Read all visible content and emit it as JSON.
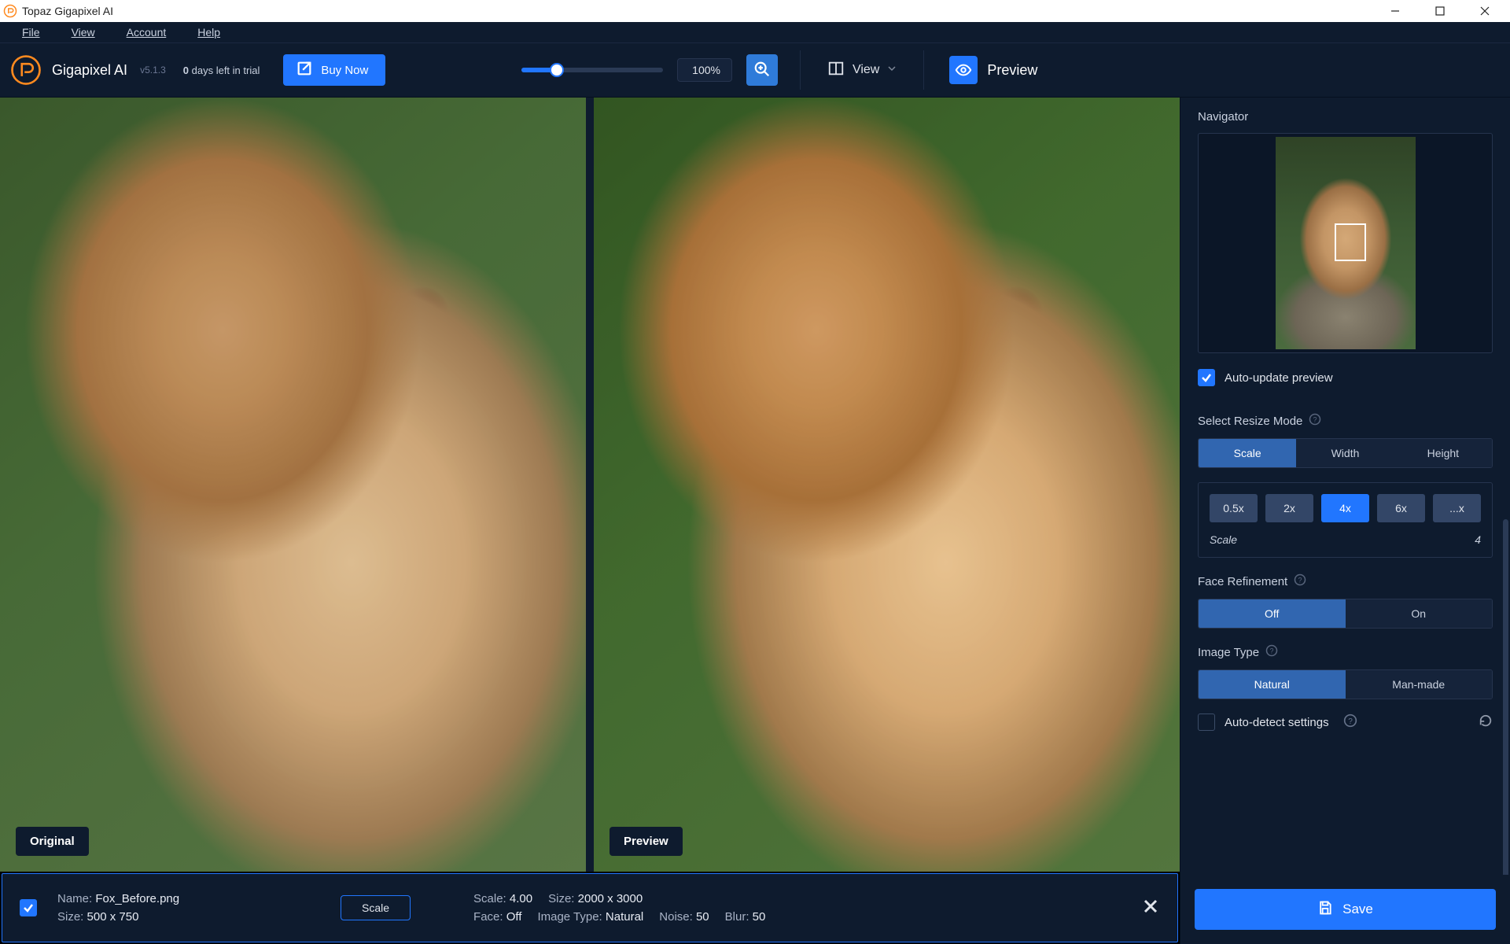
{
  "window": {
    "title": "Topaz Gigapixel AI"
  },
  "menu": {
    "file": "File",
    "view": "View",
    "account": "Account",
    "help": "Help"
  },
  "brand": {
    "name": "Gigapixel AI",
    "version": "v5.1.3",
    "trial_days": "0",
    "trial_suffix": "days left in trial",
    "buy": "Buy Now"
  },
  "toolbar": {
    "zoom_value": "100%",
    "view_label": "View",
    "preview_label": "Preview"
  },
  "compare": {
    "left_tag": "Original",
    "right_tag": "Preview"
  },
  "footer": {
    "name_label": "Name:",
    "name": "Fox_Before.png",
    "size_label": "Size:",
    "size": "500 x 750",
    "scale_btn": "Scale",
    "out_scale_label": "Scale:",
    "out_scale": "4.00",
    "out_size_label": "Size:",
    "out_size": "2000 x 3000",
    "face_label": "Face:",
    "face": "Off",
    "type_label": "Image Type:",
    "type": "Natural",
    "noise_label": "Noise:",
    "noise": "50",
    "blur_label": "Blur:",
    "blur": "50"
  },
  "side": {
    "navigator": "Navigator",
    "auto_update": "Auto-update preview",
    "resize_mode": "Select Resize Mode",
    "modes": {
      "scale": "Scale",
      "width": "Width",
      "height": "Height"
    },
    "scales": {
      "s05": "0.5x",
      "s2": "2x",
      "s4": "4x",
      "s6": "6x",
      "sx": "...x"
    },
    "scale_label": "Scale",
    "scale_value": "4",
    "face_ref": "Face Refinement",
    "face_opts": {
      "off": "Off",
      "on": "On"
    },
    "image_type": "Image Type",
    "type_opts": {
      "natural": "Natural",
      "manmade": "Man-made"
    },
    "auto_detect": "Auto-detect settings",
    "save": "Save"
  }
}
